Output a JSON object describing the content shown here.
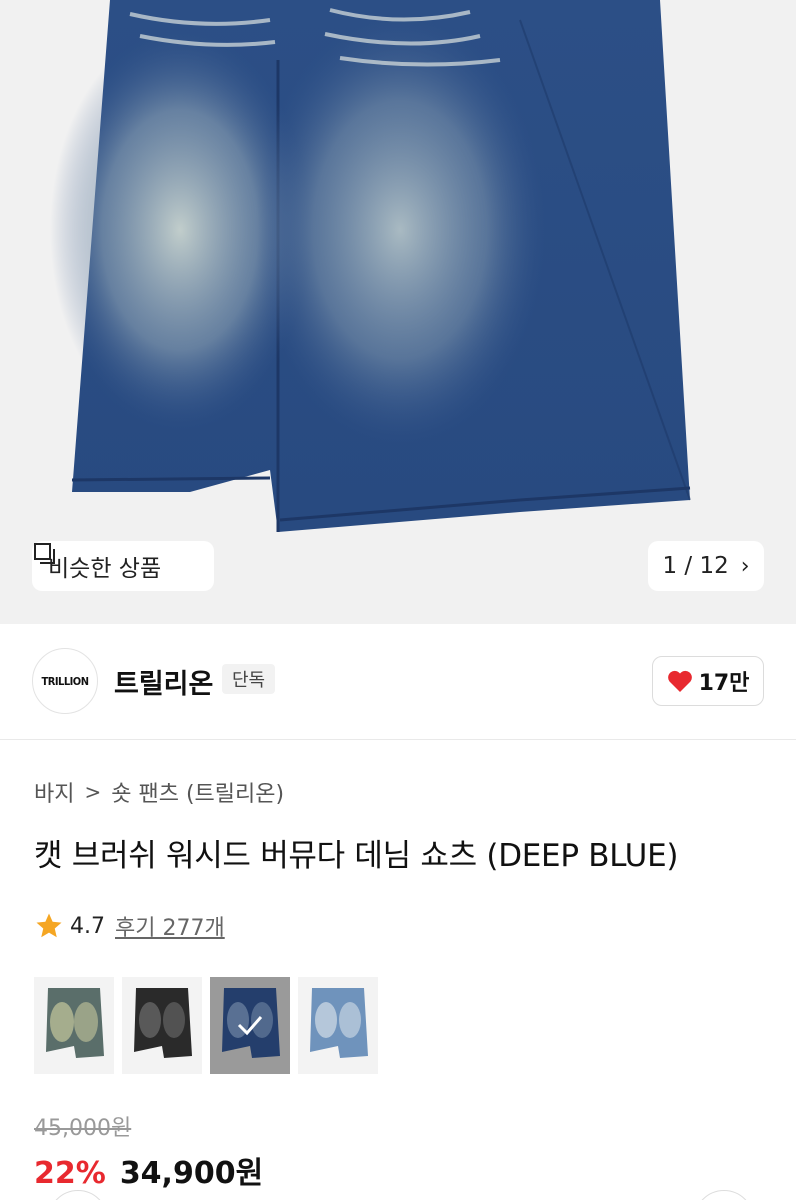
{
  "gallery": {
    "similar_label": "비슷한 상품",
    "similar_icon": "similar-products-icon",
    "page_indicator": "1 / 12",
    "next_icon": "chevron-right-icon"
  },
  "brand": {
    "logo_text": "TRILLION",
    "name": "트릴리온",
    "badge": "단독",
    "like_count": "17만",
    "like_icon": "heart-icon"
  },
  "breadcrumb": {
    "category": "바지",
    "separator": ">",
    "subcategory": "숏 팬츠 (트릴리온)"
  },
  "product": {
    "title": "캣 브러쉬 워시드 버뮤다 데님 쇼츠 (DEEP BLUE)",
    "rating": "4.7",
    "reviews": "후기 277개",
    "original_price": "45,000원",
    "discount": "22%",
    "price": "34,900원"
  },
  "colors": {
    "accent_red": "#e8292f",
    "star": "#f5a623"
  },
  "swatches": [
    {
      "name": "vintage-wash",
      "selected": false
    },
    {
      "name": "black",
      "selected": false
    },
    {
      "name": "deep-blue",
      "selected": true
    },
    {
      "name": "light-blue",
      "selected": false
    }
  ]
}
